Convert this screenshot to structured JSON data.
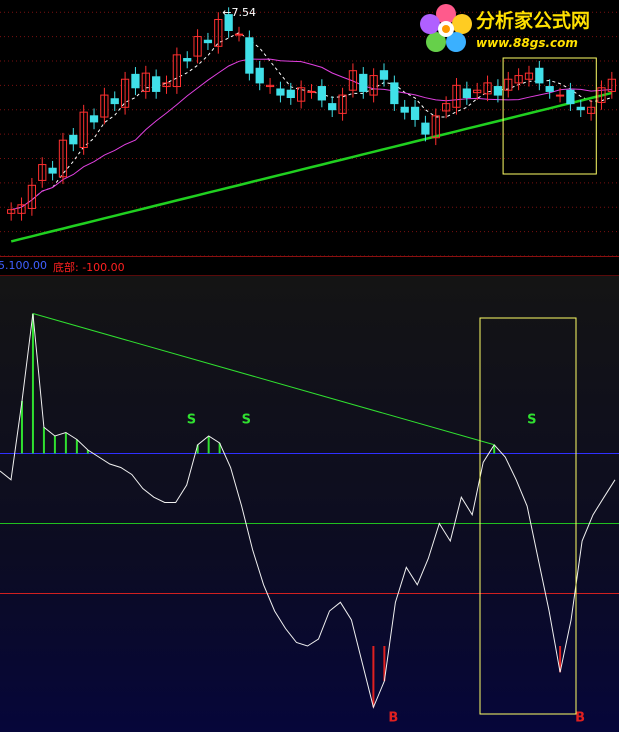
{
  "chart_data": [
    {
      "type": "candlestick",
      "title": "",
      "ylim": [
        5.6,
        7.7
      ],
      "annotations": {
        "price_marker": "7.54"
      },
      "series": [
        {
          "color": "#ffffff",
          "style": "dashed"
        },
        {
          "color": "#e040e0"
        },
        {
          "color": "#20d020"
        }
      ],
      "grid": "dotted red horizontal lines",
      "highlight_box": {
        "from_index": 48,
        "to_index": 56,
        "color": "#ffff66"
      }
    },
    {
      "type": "line",
      "header": {
        "value_text": "5.100.00",
        "label_text": "底部: -100.00"
      },
      "title": "",
      "signals": {
        "sell": [
          "S",
          "S",
          "S"
        ],
        "buy": [
          "B",
          "B"
        ]
      },
      "levels": [
        {
          "color": "#3030ff"
        },
        {
          "color": "#20c020"
        },
        {
          "color": "#d02020"
        }
      ],
      "trend_line_color": "#30e030",
      "highlight_box": {
        "color": "#ffff66"
      }
    }
  ],
  "logo": {
    "title": "分析家公式网",
    "url": "www.88gs.com"
  }
}
